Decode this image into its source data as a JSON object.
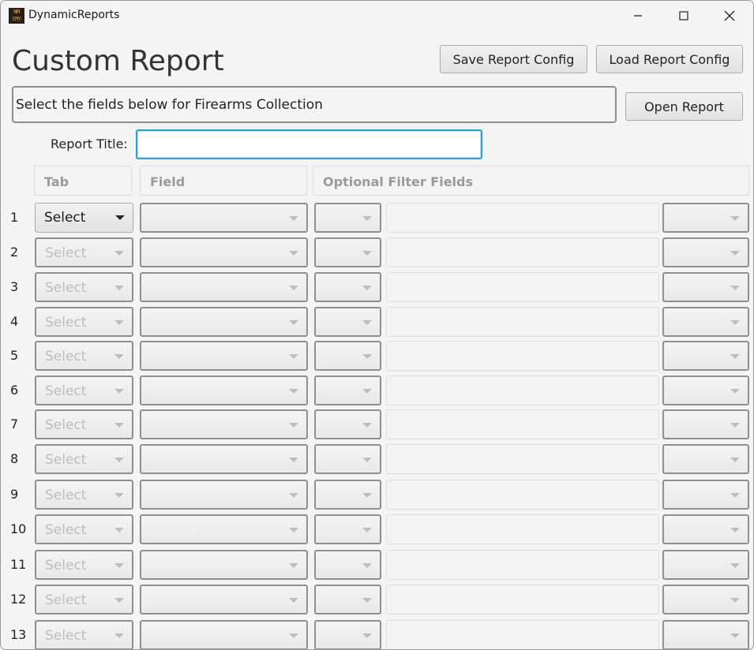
{
  "window": {
    "title": "DynamicReports",
    "icon_text": "NM\nCMY"
  },
  "header": {
    "title": "Custom Report",
    "save_label": "Save Report Config",
    "load_label": "Load Report Config",
    "open_label": "Open Report"
  },
  "info": {
    "text": "Select the fields below for Firearms Collection"
  },
  "report_title": {
    "label": "Report Title:",
    "value": ""
  },
  "columns": {
    "tab": "Tab",
    "field": "Field",
    "filter": "Optional Filter Fields"
  },
  "rows": [
    {
      "num": "1",
      "tab": "Select"
    },
    {
      "num": "2",
      "tab": "Select"
    },
    {
      "num": "3",
      "tab": "Select"
    },
    {
      "num": "4",
      "tab": "Select"
    },
    {
      "num": "5",
      "tab": "Select"
    },
    {
      "num": "6",
      "tab": "Select"
    },
    {
      "num": "7",
      "tab": "Select"
    },
    {
      "num": "8",
      "tab": "Select"
    },
    {
      "num": "9",
      "tab": "Select"
    },
    {
      "num": "10",
      "tab": "Select"
    },
    {
      "num": "11",
      "tab": "Select"
    },
    {
      "num": "12",
      "tab": "Select"
    },
    {
      "num": "13",
      "tab": "Select"
    }
  ],
  "colors": {
    "focus": "#2a9fd8",
    "disabled_text": "#bdbdbd"
  }
}
